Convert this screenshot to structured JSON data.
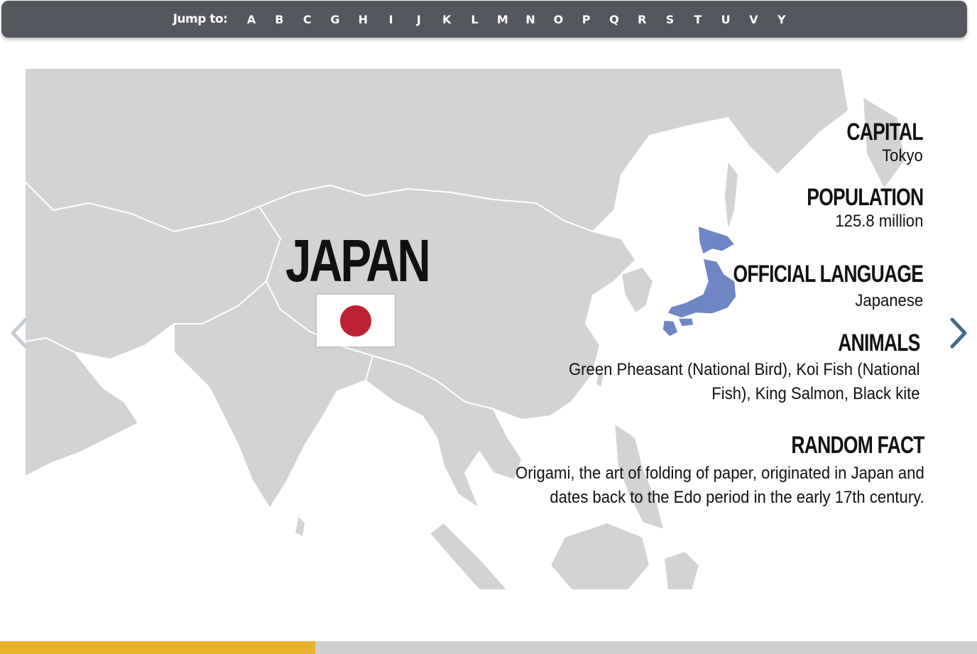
{
  "jumpbar": {
    "label": "Jump to:",
    "letters": [
      "A",
      "B",
      "C",
      "G",
      "H",
      "I",
      "J",
      "K",
      "L",
      "M",
      "N",
      "O",
      "P",
      "Q",
      "R",
      "S",
      "T",
      "U",
      "V",
      "Y"
    ]
  },
  "country": {
    "name": "JAPAN",
    "flag_icon": "japan-flag",
    "map_highlight_color": "#6f86c4"
  },
  "info": {
    "capital": {
      "heading": "CAPITAL",
      "value": "Tokyo"
    },
    "population": {
      "heading": "POPULATION",
      "value": "125.8 million"
    },
    "language": {
      "heading": "OFFICIAL LANGUAGE",
      "value": "Japanese"
    },
    "animals": {
      "heading": "ANIMALS",
      "line1": "Green Pheasant (National Bird), Koi Fish (National",
      "line2": "Fish), King Salmon, Black kite"
    },
    "fact": {
      "heading": "RANDOM FACT",
      "line1": "Origami, the art of folding of paper, originated in Japan and",
      "line2": "dates back to the Edo period in the early 17th century."
    }
  },
  "navigation": {
    "prev_icon": "chevron-left-icon",
    "next_icon": "chevron-right-icon"
  },
  "progress": {
    "fraction": 0.3227,
    "fill_color": "#e8b22e",
    "track_color": "#cfcfcf"
  }
}
